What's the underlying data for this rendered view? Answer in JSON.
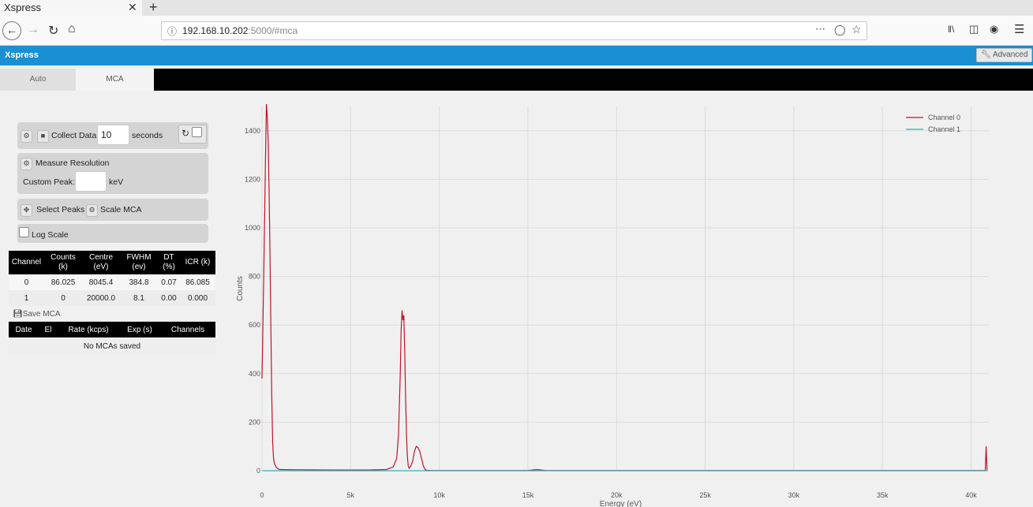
{
  "browser": {
    "tab_title": "Xspress",
    "tab_close": "✕",
    "new_tab": "+",
    "url_host": "192.168.10.202",
    "url_rest": ":5000/#mca"
  },
  "app": {
    "title": "Xspress",
    "advanced_label": "Advanced"
  },
  "tabs": [
    {
      "label": "Auto",
      "active": false
    },
    {
      "label": "MCA",
      "active": true
    }
  ],
  "controls": {
    "collect_label": "Collect Data",
    "collect_value": "10",
    "seconds_label": "seconds",
    "measure_label": "Measure Resolution",
    "custom_peak_label": "Custom Peak:",
    "custom_peak_value": "",
    "kev_label": "keV",
    "select_peaks_label": "Select Peaks",
    "scale_mca_label": "Scale MCA",
    "log_scale_label": "Log Scale"
  },
  "channel_table": {
    "headers": [
      "Channel",
      "Counts\n(k)",
      "Centre\n(eV)",
      "FWHM\n(ev)",
      "DT\n(%)",
      "ICR (k)"
    ],
    "rows": [
      [
        "0",
        "86.025",
        "8045.4",
        "384.8",
        "0.07",
        "86.085"
      ],
      [
        "1",
        "0",
        "20000.0",
        "8.1",
        "0.00",
        "0.000"
      ]
    ]
  },
  "save_mca_label": "Save MCA",
  "mca_table": {
    "headers": [
      "Date",
      "El",
      "Rate (kcps)",
      "Exp (s)",
      "Channels"
    ],
    "empty_text": "No MCAs saved"
  },
  "colors": {
    "app_bar": "#1a8fd1",
    "channel_0": "#c0142c",
    "channel_1": "#29b7b7"
  },
  "chart_data": {
    "type": "line",
    "xlabel": "Energy (eV)",
    "ylabel": "Counts",
    "xlim": [
      0,
      41000
    ],
    "ylim": [
      0,
      1500
    ],
    "xticks": [
      0,
      5000,
      10000,
      15000,
      20000,
      25000,
      30000,
      35000,
      40000
    ],
    "xtick_labels": [
      "0",
      "5k",
      "10k",
      "15k",
      "20k",
      "25k",
      "30k",
      "35k",
      "40k"
    ],
    "yticks": [
      0,
      200,
      400,
      600,
      800,
      1000,
      1200,
      1400
    ],
    "legend_position": "top-right",
    "grid": true,
    "series": [
      {
        "name": "Channel 0",
        "x": [
          0,
          100,
          200,
          250,
          300,
          350,
          400,
          450,
          500,
          550,
          600,
          650,
          700,
          800,
          900,
          1000,
          2000,
          4000,
          6000,
          7000,
          7400,
          7600,
          7700,
          7800,
          7850,
          7900,
          7950,
          8000,
          8050,
          8100,
          8150,
          8200,
          8250,
          8300,
          8400,
          8500,
          8600,
          8700,
          8800,
          8900,
          9000,
          9100,
          9200,
          9300,
          9500,
          10000,
          15000,
          15500,
          16000,
          20000,
          30000,
          40800,
          40850,
          40900
        ],
        "y": [
          380,
          800,
          1300,
          1510,
          1460,
          1350,
          1150,
          900,
          600,
          300,
          120,
          50,
          30,
          15,
          8,
          5,
          4,
          3,
          3,
          5,
          15,
          50,
          150,
          400,
          580,
          660,
          620,
          640,
          500,
          300,
          150,
          60,
          20,
          10,
          20,
          40,
          80,
          100,
          95,
          80,
          50,
          20,
          5,
          2,
          1,
          1,
          1,
          5,
          1,
          1,
          1,
          1,
          100,
          1
        ]
      },
      {
        "name": "Channel 1",
        "x": [
          0,
          40900
        ],
        "y": [
          0,
          0
        ]
      }
    ]
  }
}
